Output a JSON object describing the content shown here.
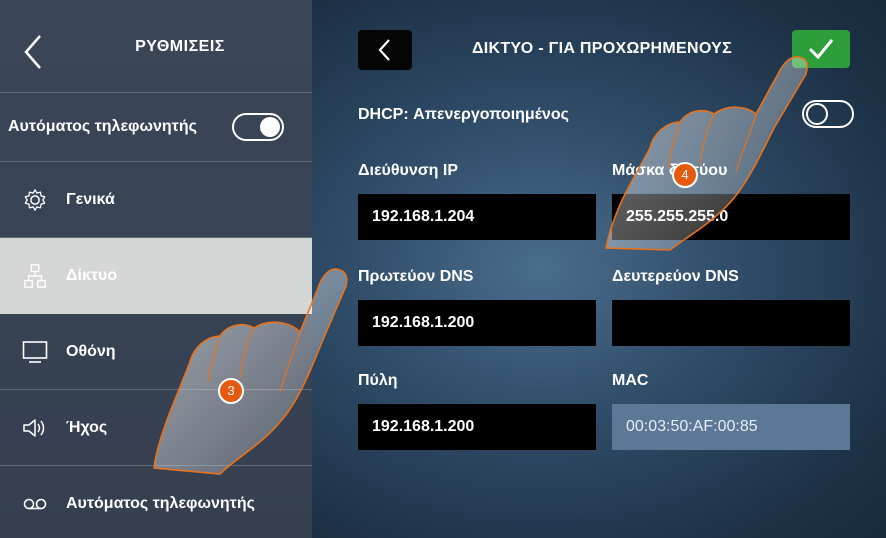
{
  "sidebar": {
    "title": "ΡΥΘΜΙΣΕΙΣ",
    "answering_toggle_label": "Αυτόματος τηλεφωνητής",
    "answering_toggle_state": "on",
    "items": [
      {
        "label": "Γενικά",
        "icon": "gear-icon",
        "active": false
      },
      {
        "label": "Δίκτυο",
        "icon": "network-icon",
        "active": true
      },
      {
        "label": "Οθόνη",
        "icon": "monitor-icon",
        "active": false
      },
      {
        "label": "Ήχος",
        "icon": "speaker-icon",
        "active": false
      },
      {
        "label": "Αυτόματος τηλεφωνητής",
        "icon": "voicemail-icon",
        "active": false
      }
    ]
  },
  "main": {
    "title": "ΔΙΚΤΥΟ - ΓΙΑ ΠΡΟΧΩΡΗΜΕΝΟΥΣ",
    "dhcp_label": "DHCP: Απενεργοποιημένος",
    "dhcp_toggle_state": "off",
    "fields": {
      "ip": {
        "label": "Διεύθυνση IP",
        "value": "192.168.1.204"
      },
      "mask": {
        "label": "Μάσκα δικτύου",
        "value": "255.255.255.0"
      },
      "dns1": {
        "label": "Πρωτεύον DNS",
        "value": "192.168.1.200"
      },
      "dns2": {
        "label": "Δευτερεύον DNS",
        "value": ""
      },
      "gateway": {
        "label": "Πύλη",
        "value": "192.168.1.200"
      },
      "mac": {
        "label": "MAC",
        "value": "00:03:50:AF:00:85"
      }
    }
  },
  "annotations": {
    "step_3": "3",
    "step_4": "4"
  },
  "colors": {
    "sidebar_bg": "#3a4658",
    "active_item_bg": "#d5d6d6",
    "confirm_green": "#2e9e3a",
    "field_bg": "#000000",
    "readonly_field_bg": "#5b7896",
    "step_badge": "#e65a10"
  }
}
